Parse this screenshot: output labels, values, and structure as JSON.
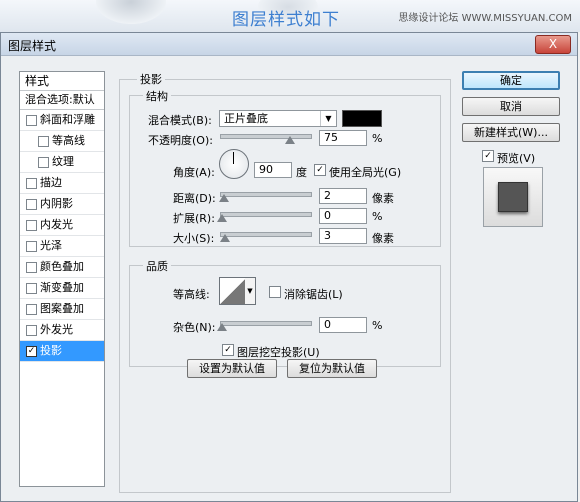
{
  "banner": {
    "title": "图层样式如下",
    "site": "思缘设计论坛 WWW.MISSYUAN.COM"
  },
  "window": {
    "title": "图层样式",
    "close_label": "X"
  },
  "styles_panel": {
    "header": "样式",
    "blend_options": "混合选项:默认",
    "items": [
      {
        "label": "斜面和浮雕",
        "checked": false
      },
      {
        "label": "等高线",
        "checked": false
      },
      {
        "label": "纹理",
        "checked": false
      },
      {
        "label": "描边",
        "checked": false
      },
      {
        "label": "内阴影",
        "checked": false
      },
      {
        "label": "内发光",
        "checked": false
      },
      {
        "label": "光泽",
        "checked": false
      },
      {
        "label": "颜色叠加",
        "checked": false
      },
      {
        "label": "渐变叠加",
        "checked": false
      },
      {
        "label": "图案叠加",
        "checked": false
      },
      {
        "label": "外发光",
        "checked": false
      },
      {
        "label": "投影",
        "checked": true
      }
    ]
  },
  "drop_shadow": {
    "section_title": "投影",
    "structure": {
      "title": "结构",
      "blend_mode_label": "混合模式(B):",
      "blend_mode_value": "正片叠底",
      "shadow_color": "#000000",
      "opacity_label": "不透明度(O):",
      "opacity_value": "75",
      "opacity_unit": "%",
      "angle_label": "角度(A):",
      "angle_value": "90",
      "angle_unit": "度",
      "global_light_label": "使用全局光(G)",
      "global_light_checked": true,
      "distance_label": "距离(D):",
      "distance_value": "2",
      "distance_unit": "像素",
      "spread_label": "扩展(R):",
      "spread_value": "0",
      "spread_unit": "%",
      "size_label": "大小(S):",
      "size_value": "3",
      "size_unit": "像素"
    },
    "quality": {
      "title": "品质",
      "contour_label": "等高线:",
      "antialias_label": "消除锯齿(L)",
      "antialias_checked": false,
      "noise_label": "杂色(N):",
      "noise_value": "0",
      "noise_unit": "%"
    },
    "knockout_label": "图层挖空投影(U)",
    "knockout_checked": true,
    "make_default_label": "设置为默认值",
    "reset_default_label": "复位为默认值"
  },
  "actions": {
    "ok_label": "确定",
    "cancel_label": "取消",
    "new_style_label": "新建样式(W)...",
    "preview_label": "预览(V)",
    "preview_checked": true
  },
  "sliders": {
    "opacity": 0.75,
    "distance": 0.02,
    "spread": 0.0,
    "size": 0.03,
    "noise": 0.0
  },
  "check_glyph": "✓"
}
